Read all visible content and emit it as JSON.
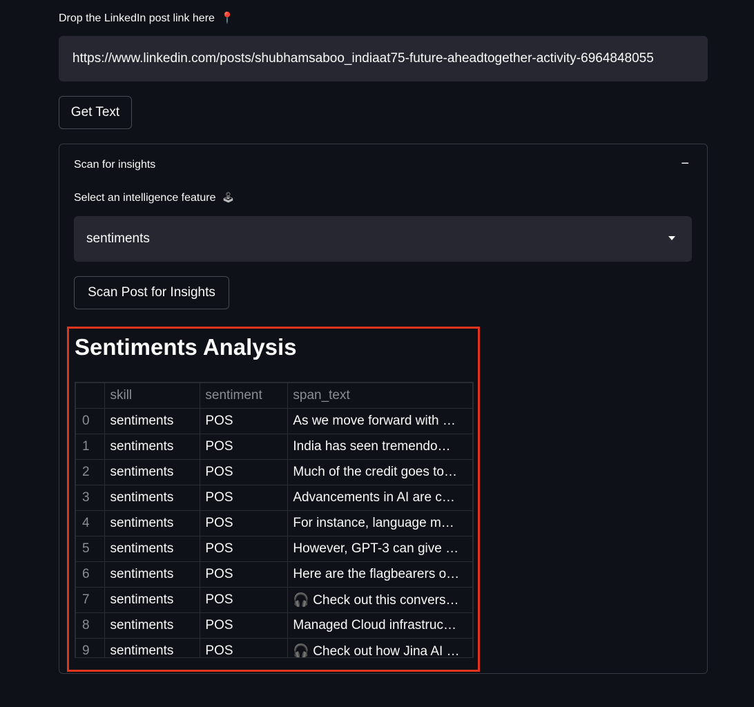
{
  "link_section": {
    "label": "Drop the LinkedIn post link here",
    "label_icon": "pushpin-icon",
    "url_value": "https://www.linkedin.com/posts/shubhamsaboo_indiaat75-future-aheadtogether-activity-6964848055"
  },
  "get_text_button": "Get Text",
  "expander": {
    "title": "Scan for insights",
    "collapse_symbol": "−",
    "select_label": "Select an intelligence feature",
    "select_label_icon": "joystick-icon",
    "selected_value": "sentiments",
    "scan_button": "Scan Post for Insights"
  },
  "results": {
    "title": "Sentiments Analysis",
    "columns": [
      "",
      "skill",
      "sentiment",
      "span_text"
    ],
    "rows": [
      {
        "index": "0",
        "skill": "sentiments",
        "sentiment": "POS",
        "span_text": "As we move forward with …"
      },
      {
        "index": "1",
        "skill": "sentiments",
        "sentiment": "POS",
        "span_text": "India has seen tremendo…"
      },
      {
        "index": "2",
        "skill": "sentiments",
        "sentiment": "POS",
        "span_text": "Much of the credit goes to…"
      },
      {
        "index": "3",
        "skill": "sentiments",
        "sentiment": "POS",
        "span_text": "Advancements in AI are c…"
      },
      {
        "index": "4",
        "skill": "sentiments",
        "sentiment": "POS",
        "span_text": "For instance, language m…"
      },
      {
        "index": "5",
        "skill": "sentiments",
        "sentiment": "POS",
        "span_text": "However, GPT-3 can give …"
      },
      {
        "index": "6",
        "skill": "sentiments",
        "sentiment": "POS",
        "span_text": "Here are the flagbearers o…"
      },
      {
        "index": "7",
        "skill": "sentiments",
        "sentiment": "POS",
        "span_text": "🎧 Check out this convers…"
      },
      {
        "index": "8",
        "skill": "sentiments",
        "sentiment": "POS",
        "span_text": "Managed Cloud infrastruc…"
      },
      {
        "index": "9",
        "skill": "sentiments",
        "sentiment": "POS",
        "span_text": "🎧 Check out how Jina AI …"
      }
    ]
  },
  "colors": {
    "background": "#0e1117",
    "input_bg": "#262730",
    "highlight_border": "#e0341f"
  }
}
